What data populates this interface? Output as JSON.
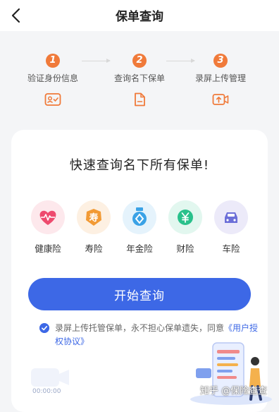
{
  "header": {
    "title": "保单查询"
  },
  "steps": [
    {
      "num": "1",
      "label": "验证身份信息",
      "icon": "id-card-check-icon"
    },
    {
      "num": "2",
      "label": "查询名下保单",
      "icon": "document-icon"
    },
    {
      "num": "3",
      "label": "录屏上传管理",
      "icon": "upload-video-icon"
    }
  ],
  "card": {
    "title": "快速查询名下所有保单!",
    "types": [
      {
        "label": "健康险",
        "icon": "heart-pulse-icon",
        "color": "#ee4a6e"
      },
      {
        "label": "寿险",
        "icon": "longevity-icon",
        "color": "#f29a34"
      },
      {
        "label": "年金险",
        "icon": "medal-icon",
        "color": "#3aa2e6"
      },
      {
        "label": "财险",
        "icon": "yen-icon",
        "color": "#29c18b"
      },
      {
        "label": "车险",
        "icon": "car-icon",
        "color": "#6c6fd8"
      }
    ],
    "start_button": "开始查询",
    "agreement": {
      "text": "录屏上传托管保单，永不担心保单遗失，同意",
      "link": "《用户授权协议》"
    }
  },
  "recorder": {
    "time": "00:00:00"
  },
  "watermark": "知乎 @保险查查",
  "colors": {
    "accent": "#3d68e6",
    "step": "#f07a3a"
  }
}
